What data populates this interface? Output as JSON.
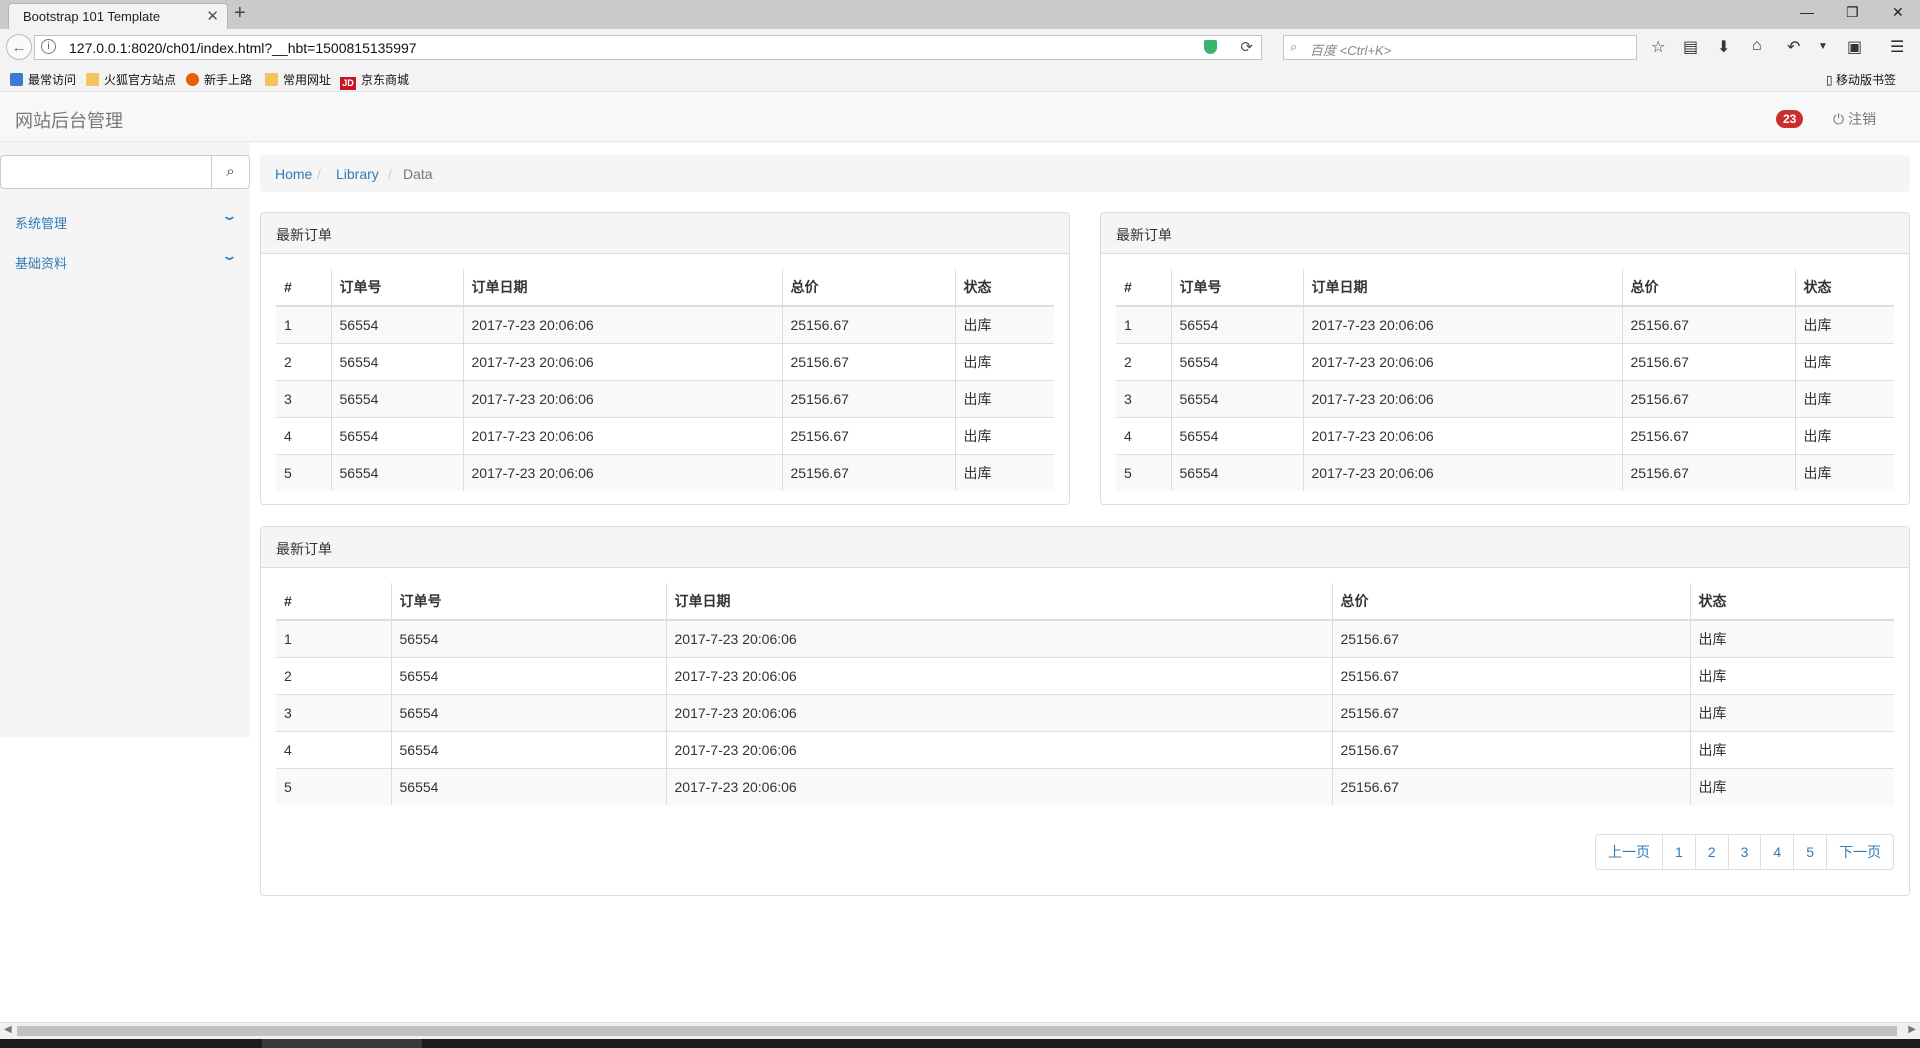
{
  "browser": {
    "tab_title": "Bootstrap 101 Template",
    "tab_close": "✕",
    "new_tab": "+",
    "window_controls": [
      "—",
      "❐",
      "✕"
    ],
    "url": "127.0.0.1:8020/ch01/index.html?__hbt=1500815135997",
    "search_placeholder": "百度 <Ctrl+K>",
    "bookmarks": [
      "最常访问",
      "火狐官方站点",
      "新手上路",
      "常用网址",
      "京东商城"
    ],
    "jd_icon_text": "JD",
    "mobile_bookmarks": "移动版书签"
  },
  "navbar": {
    "brand": "网站后台管理",
    "badge": "23",
    "logout": "注销"
  },
  "sidebar": {
    "search_placeholder": "",
    "items": [
      {
        "label": "系统管理"
      },
      {
        "label": "基础资料"
      }
    ]
  },
  "breadcrumb": {
    "items": [
      "Home",
      "Library"
    ],
    "active": "Data",
    "separator": "/"
  },
  "panels": [
    {
      "title": "最新订单"
    },
    {
      "title": "最新订单"
    },
    {
      "title": "最新订单"
    }
  ],
  "table": {
    "headers": [
      "#",
      "订单号",
      "订单日期",
      "总价",
      "状态"
    ],
    "rows": [
      [
        "1",
        "56554",
        "2017-7-23 20:06:06",
        "25156.67",
        "出库"
      ],
      [
        "2",
        "56554",
        "2017-7-23 20:06:06",
        "25156.67",
        "出库"
      ],
      [
        "3",
        "56554",
        "2017-7-23 20:06:06",
        "25156.67",
        "出库"
      ],
      [
        "4",
        "56554",
        "2017-7-23 20:06:06",
        "25156.67",
        "出库"
      ],
      [
        "5",
        "56554",
        "2017-7-23 20:06:06",
        "25156.67",
        "出库"
      ]
    ]
  },
  "pagination": {
    "prev": "上一页",
    "pages": [
      "1",
      "2",
      "3",
      "4",
      "5"
    ],
    "next": "下一页"
  },
  "colors": {
    "link": "#337ab7",
    "badge": "#c9302c",
    "panel_heading": "#f5f5f5"
  }
}
